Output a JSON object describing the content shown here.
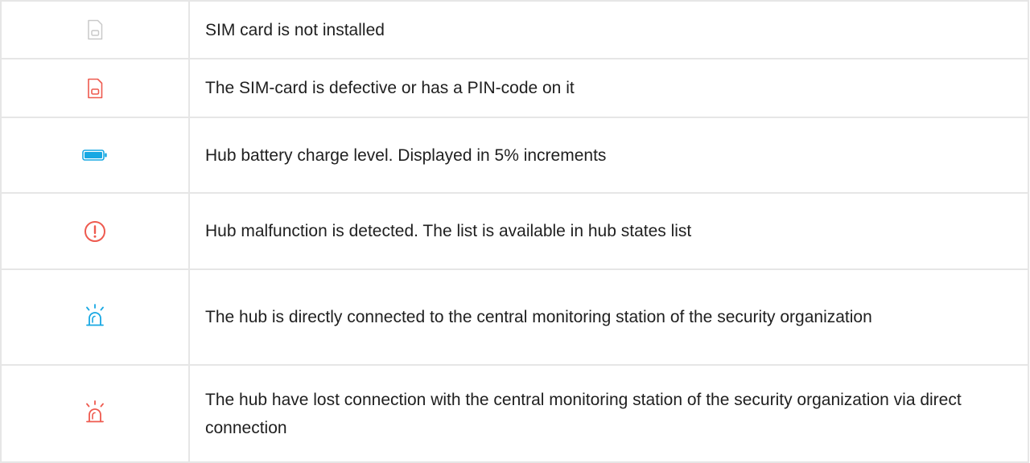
{
  "colors": {
    "gray": "#c9c9c9",
    "red": "#ee5a4f",
    "blue": "#17a8e3",
    "border": "#e6e6e6",
    "text": "#1f1f1f"
  },
  "rows": [
    {
      "icon": "sim-card-not-installed-icon",
      "text": "SIM card is not installed"
    },
    {
      "icon": "sim-card-defective-icon",
      "text": "The SIM-card is defective or has a PIN-code on it"
    },
    {
      "icon": "battery-icon",
      "text": "Hub battery charge level. Displayed in 5% increments"
    },
    {
      "icon": "malfunction-icon",
      "text": "Hub malfunction is detected. The list is available in hub states list"
    },
    {
      "icon": "monitoring-station-connected-icon",
      "text": "The hub is directly connected to the central monitoring station of the security organization"
    },
    {
      "icon": "monitoring-station-lost-icon",
      "text": "The hub have lost connection with the central monitoring station of the security organization via direct connection"
    }
  ]
}
